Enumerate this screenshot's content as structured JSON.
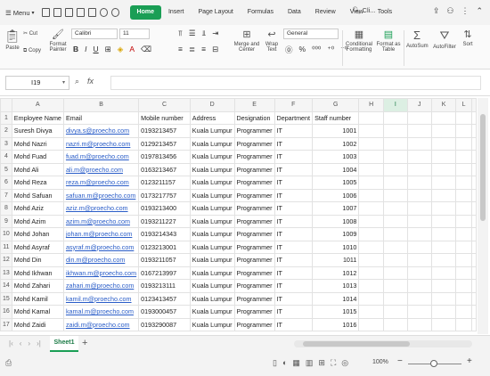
{
  "menubar": {
    "menu_label": "Menu",
    "tabs": [
      "Home",
      "Insert",
      "Page Layout",
      "Formulas",
      "Data",
      "Review",
      "View",
      "Tools"
    ],
    "active_tab": "Home",
    "search_label": "Cli..."
  },
  "ribbon": {
    "paste": "Paste",
    "cut": "Cut",
    "copy": "Copy",
    "format_painter_1": "Format",
    "format_painter_2": "Painter",
    "font_name": "Calibri",
    "font_size": "11",
    "merge_center_1": "Merge and",
    "merge_center_2": "Center",
    "wrap_text_1": "Wrap",
    "wrap_text_2": "Text",
    "number_format": "General",
    "conditional_formatting_1": "Conditional",
    "conditional_formatting_2": "Formatting",
    "format_as_table_1": "Format as",
    "format_as_table_2": "Table",
    "autosum": "AutoSum",
    "autofilter": "AutoFilter",
    "sort": "Sort"
  },
  "formula_bar": {
    "cell_ref": "I19",
    "fx_label": "fx",
    "value": ""
  },
  "grid": {
    "columns": [
      "A",
      "B",
      "C",
      "D",
      "E",
      "F",
      "G",
      "H",
      "I",
      "J",
      "K",
      "L"
    ],
    "selected_column": "I",
    "rows": [
      {
        "n": "1",
        "cells": [
          "Employee Name",
          "Email",
          "Mobile number",
          "Address",
          "Designation",
          "Department",
          "Staff number",
          "",
          "",
          "",
          "",
          ""
        ]
      },
      {
        "n": "2",
        "cells": [
          "Suresh Divya",
          "divya.s@proecho.com",
          "0193213457",
          "Kuala Lumpur",
          "Programmer",
          "IT",
          "1001",
          "",
          "",
          "",
          "",
          ""
        ]
      },
      {
        "n": "3",
        "cells": [
          "Mohd Nazri",
          "nazri.m@proecho.com",
          "0129213457",
          "Kuala Lumpur",
          "Programmer",
          "IT",
          "1002",
          "",
          "",
          "",
          "",
          ""
        ]
      },
      {
        "n": "4",
        "cells": [
          "Mohd Fuad",
          "fuad.m@proecho.com",
          "0197813456",
          "Kuala Lumpur",
          "Programmer",
          "IT",
          "1003",
          "",
          "",
          "",
          "",
          ""
        ]
      },
      {
        "n": "5",
        "cells": [
          "Mohd Ali",
          "ali.m@proecho.com",
          "0163213467",
          "Kuala Lumpur",
          "Programmer",
          "IT",
          "1004",
          "",
          "",
          "",
          "",
          ""
        ]
      },
      {
        "n": "6",
        "cells": [
          "Mohd Reza",
          "reza.m@proecho.com",
          "0123211157",
          "Kuala Lumpur",
          "Programmer",
          "IT",
          "1005",
          "",
          "",
          "",
          "",
          ""
        ]
      },
      {
        "n": "7",
        "cells": [
          "Mohd Safuan",
          "safuan.m@proecho.com",
          "0173217757",
          "Kuala Lumpur",
          "Programmer",
          "IT",
          "1006",
          "",
          "",
          "",
          "",
          ""
        ]
      },
      {
        "n": "8",
        "cells": [
          "Mohd Aziz",
          "aziz.m@proecho.com",
          "0193213400",
          "Kuala Lumpur",
          "Programmer",
          "IT",
          "1007",
          "",
          "",
          "",
          "",
          ""
        ]
      },
      {
        "n": "9",
        "cells": [
          "Mohd Azim",
          "azim.m@proecho.com",
          "0193211227",
          "Kuala Lumpur",
          "Programmer",
          "IT",
          "1008",
          "",
          "",
          "",
          "",
          ""
        ]
      },
      {
        "n": "10",
        "cells": [
          "Mohd Johan",
          "johan.m@proecho.com",
          "0193214343",
          "Kuala Lumpur",
          "Programmer",
          "IT",
          "1009",
          "",
          "",
          "",
          "",
          ""
        ]
      },
      {
        "n": "11",
        "cells": [
          "Mohd Asyraf",
          "asyraf.m@proecho.com",
          "0123213001",
          "Kuala Lumpur",
          "Programmer",
          "IT",
          "1010",
          "",
          "",
          "",
          "",
          ""
        ]
      },
      {
        "n": "12",
        "cells": [
          "Mohd Din",
          "din.m@proecho.com",
          "0193211057",
          "Kuala Lumpur",
          "Programmer",
          "IT",
          "1011",
          "",
          "",
          "",
          "",
          ""
        ]
      },
      {
        "n": "13",
        "cells": [
          "Mohd Ikhwan",
          "ikhwan.m@proecho.com",
          "0167213997",
          "Kuala Lumpur",
          "Programmer",
          "IT",
          "1012",
          "",
          "",
          "",
          "",
          ""
        ]
      },
      {
        "n": "14",
        "cells": [
          "Mohd Zahari",
          "zahari.m@proecho.com",
          "0193213111",
          "Kuala Lumpur",
          "Programmer",
          "IT",
          "1013",
          "",
          "",
          "",
          "",
          ""
        ]
      },
      {
        "n": "15",
        "cells": [
          "Mohd Kamil",
          "kamil.m@proecho.com",
          "0123413457",
          "Kuala Lumpur",
          "Programmer",
          "IT",
          "1014",
          "",
          "",
          "",
          "",
          ""
        ]
      },
      {
        "n": "16",
        "cells": [
          "Mohd Kamal",
          "kamal.m@proecho.com",
          "0193000457",
          "Kuala Lumpur",
          "Programmer",
          "IT",
          "1015",
          "",
          "",
          "",
          "",
          ""
        ]
      },
      {
        "n": "17",
        "cells": [
          "Mohd Zaidi",
          "zaidi.m@proecho.com",
          "0193290087",
          "Kuala Lumpur",
          "Programmer",
          "IT",
          "1016",
          "",
          "",
          "",
          "",
          ""
        ]
      }
    ]
  },
  "sheets": {
    "tabs": [
      "Sheet1"
    ],
    "active": "Sheet1"
  },
  "status": {
    "zoom": "100%"
  },
  "colors": {
    "accent": "#1a9e55",
    "link": "#2a5dc8"
  }
}
